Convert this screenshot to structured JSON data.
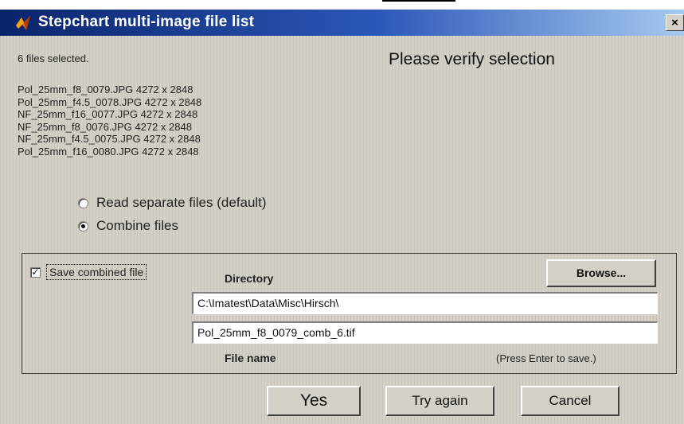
{
  "window": {
    "title": "Stepchart multi-image file list",
    "close_label": "×",
    "icon": "matlab-icon"
  },
  "status": {
    "selected_count_text": "6 files selected."
  },
  "heading": "Please verify selection",
  "files": [
    "Pol_25mm_f8_0079.JPG   4272 x 2848",
    "Pol_25mm_f4.5_0078.JPG   4272 x 2848",
    "NF_25mm_f16_0077.JPG   4272 x 2848",
    "NF_25mm_f8_0076.JPG   4272 x 2848",
    "NF_25mm_f4.5_0075.JPG   4272 x 2848",
    "Pol_25mm_f16_0080.JPG   4272 x 2848"
  ],
  "mode_options": {
    "separate": {
      "label": "Read separate files (default)",
      "selected": false
    },
    "combine": {
      "label": "Combine files",
      "selected": true
    }
  },
  "save_group": {
    "checkbox_label": "Save combined file",
    "checked": true,
    "checkmark": "✓",
    "directory_label": "Directory",
    "browse_label": "Browse...",
    "directory_value": "C:\\Imatest\\Data\\Misc\\Hirsch\\",
    "filename_value": "Pol_25mm_f8_0079_comb_6.tif",
    "filename_label": "File name",
    "hint": "(Press Enter to save.)"
  },
  "actions": {
    "yes": "Yes",
    "try_again": "Try again",
    "cancel": "Cancel"
  },
  "colors": {
    "title_bar_start": "#0a246a",
    "title_bar_end": "#a6caf0",
    "dialog_bg": "#d4d0c8"
  }
}
